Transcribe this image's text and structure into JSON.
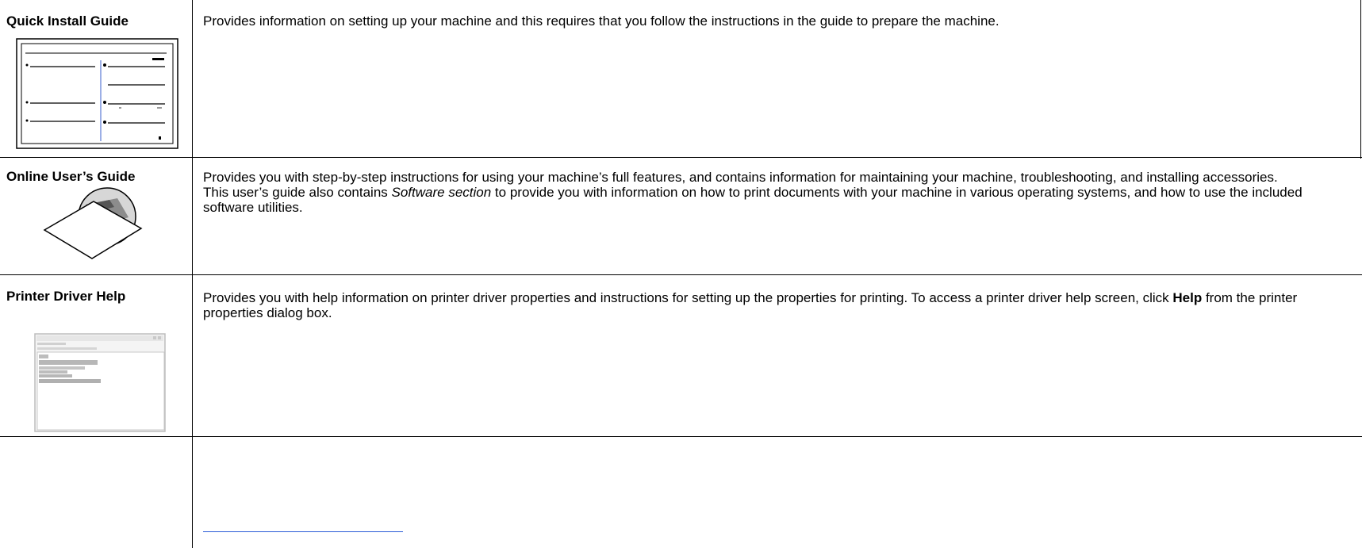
{
  "rows": [
    {
      "title": "Quick Install Guide",
      "description": "Provides information on setting up your machine and this requires that you follow the instructions in the guide to prepare the machine."
    },
    {
      "title": "Online User’s Guide",
      "description_p1": "Provides you with step-by-step instructions for using your machine’s full features, and contains information for maintaining your machine, troubleshooting, and installing accessories.",
      "description_p2_before": "This user’s guide also contains ",
      "description_p2_em": "Software section",
      "description_p2_after": " to provide you with information on how to print documents with your machine in various operating systems, and how to use the included software utilities."
    },
    {
      "title": "Printer Driver Help",
      "description_before": "Provides you with help information on printer driver properties and instructions for setting up the properties for printing. To access a printer driver help screen, click ",
      "description_bold": "Help",
      "description_after": " from the printer properties dialog box."
    }
  ],
  "icons": {
    "row1": "quick-install-guide-thumbnail",
    "row2": "cd-sleeve-icon",
    "row3": "help-window-thumbnail"
  },
  "colors": {
    "border": "#000000",
    "link": "#2a5bd7"
  }
}
